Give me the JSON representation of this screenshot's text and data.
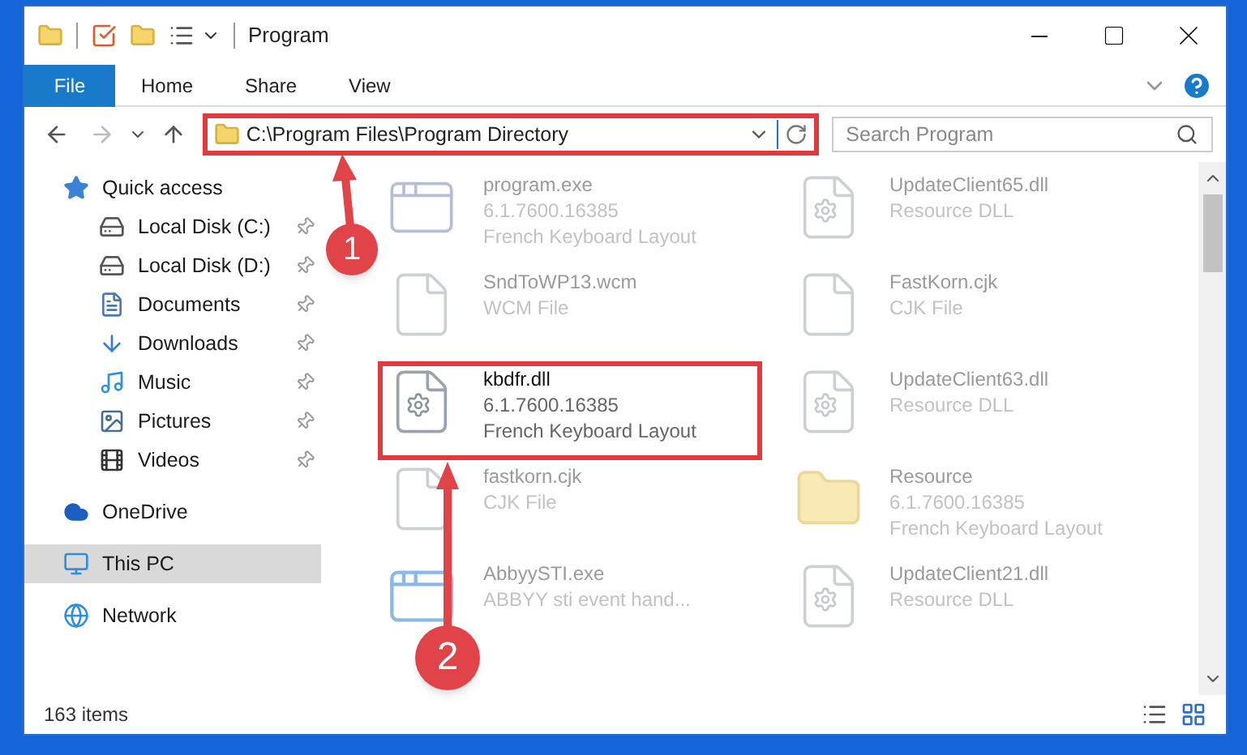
{
  "window": {
    "title": "Program"
  },
  "ribbon_tabs": [
    {
      "label": "File",
      "selected": true
    },
    {
      "label": "Home",
      "selected": false
    },
    {
      "label": "Share",
      "selected": false
    },
    {
      "label": "View",
      "selected": false
    }
  ],
  "nav": {
    "back_disabled": false,
    "forward_disabled": true
  },
  "address": {
    "value": "C:\\Program Files\\Program Directory"
  },
  "search": {
    "placeholder": "Search Program"
  },
  "sidebar": {
    "items": [
      {
        "label": "Quick access",
        "kind": "star",
        "pinned": false,
        "selected": false,
        "children": [
          {
            "label": "Local Disk (C:)",
            "kind": "disk",
            "pinned": true,
            "selected": false
          },
          {
            "label": "Local Disk (D:)",
            "kind": "disk",
            "pinned": true,
            "selected": false
          },
          {
            "label": "Documents",
            "kind": "document",
            "pinned": true,
            "selected": false
          },
          {
            "label": "Downloads",
            "kind": "download",
            "pinned": true,
            "selected": false
          },
          {
            "label": "Music",
            "kind": "music",
            "pinned": true,
            "selected": false
          },
          {
            "label": "Pictures",
            "kind": "pictures",
            "pinned": true,
            "selected": false
          },
          {
            "label": "Videos",
            "kind": "videos",
            "pinned": true,
            "selected": false
          }
        ]
      },
      {
        "label": "OneDrive",
        "kind": "cloud",
        "pinned": false,
        "selected": false
      },
      {
        "label": "This PC",
        "kind": "pc",
        "pinned": false,
        "selected": true
      },
      {
        "label": "Network",
        "kind": "network",
        "pinned": false,
        "selected": false
      }
    ]
  },
  "files": [
    {
      "name": "program.exe",
      "details": [
        "6.1.7600.16385",
        "French Keyboard Layout"
      ],
      "kind": "exe",
      "blurred": true
    },
    {
      "name": "UpdateClient65.dll",
      "details": [
        "Resource DLL"
      ],
      "kind": "dll",
      "blurred": true
    },
    {
      "name": "SndToWP13.wcm",
      "details": [
        "WCM File"
      ],
      "kind": "file",
      "blurred": true
    },
    {
      "name": "FastKorn.cjk",
      "details": [
        "CJK File"
      ],
      "kind": "file",
      "blurred": true
    },
    {
      "name": "kbdfr.dll",
      "details": [
        "6.1.7600.16385",
        "French Keyboard Layout"
      ],
      "kind": "dll",
      "blurred": false
    },
    {
      "name": "UpdateClient63.dll",
      "details": [
        "Resource DLL"
      ],
      "kind": "dll",
      "blurred": true
    },
    {
      "name": "fastkorn.cjk",
      "details": [
        "CJK File"
      ],
      "kind": "file",
      "blurred": true
    },
    {
      "name": "Resource",
      "details": [
        "6.1.7600.16385",
        "French Keyboard Layout"
      ],
      "kind": "folder",
      "blurred": true
    },
    {
      "name": "AbbyySTI.exe",
      "details": [
        "ABBYY sti event hand..."
      ],
      "kind": "app",
      "blurred": true
    },
    {
      "name": "UpdateClient21.dll",
      "details": [
        "Resource DLL"
      ],
      "kind": "dll",
      "blurred": true
    }
  ],
  "status_bar": {
    "count": "163 items"
  },
  "annotations": [
    {
      "label": "1"
    },
    {
      "label": "2"
    }
  ]
}
